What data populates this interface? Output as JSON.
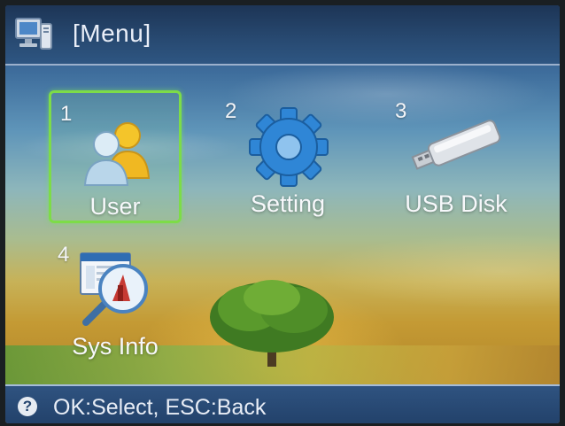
{
  "header": {
    "title": "[Menu]",
    "icon": "computer-monitor-icon"
  },
  "menu": {
    "items": [
      {
        "number": "1",
        "label": "User",
        "icon": "users-icon",
        "selected": true
      },
      {
        "number": "2",
        "label": "Setting",
        "icon": "gear-icon",
        "selected": false
      },
      {
        "number": "3",
        "label": "USB Disk",
        "icon": "usb-drive-icon",
        "selected": false
      },
      {
        "number": "4",
        "label": "Sys Info",
        "icon": "system-info-magnifier-icon",
        "selected": false
      }
    ]
  },
  "footer": {
    "help": "help-icon",
    "hint": "OK:Select, ESC:Back"
  },
  "colors": {
    "selection": "#7ddc48",
    "bar": "#284a72",
    "text": "#f7f8fb"
  }
}
